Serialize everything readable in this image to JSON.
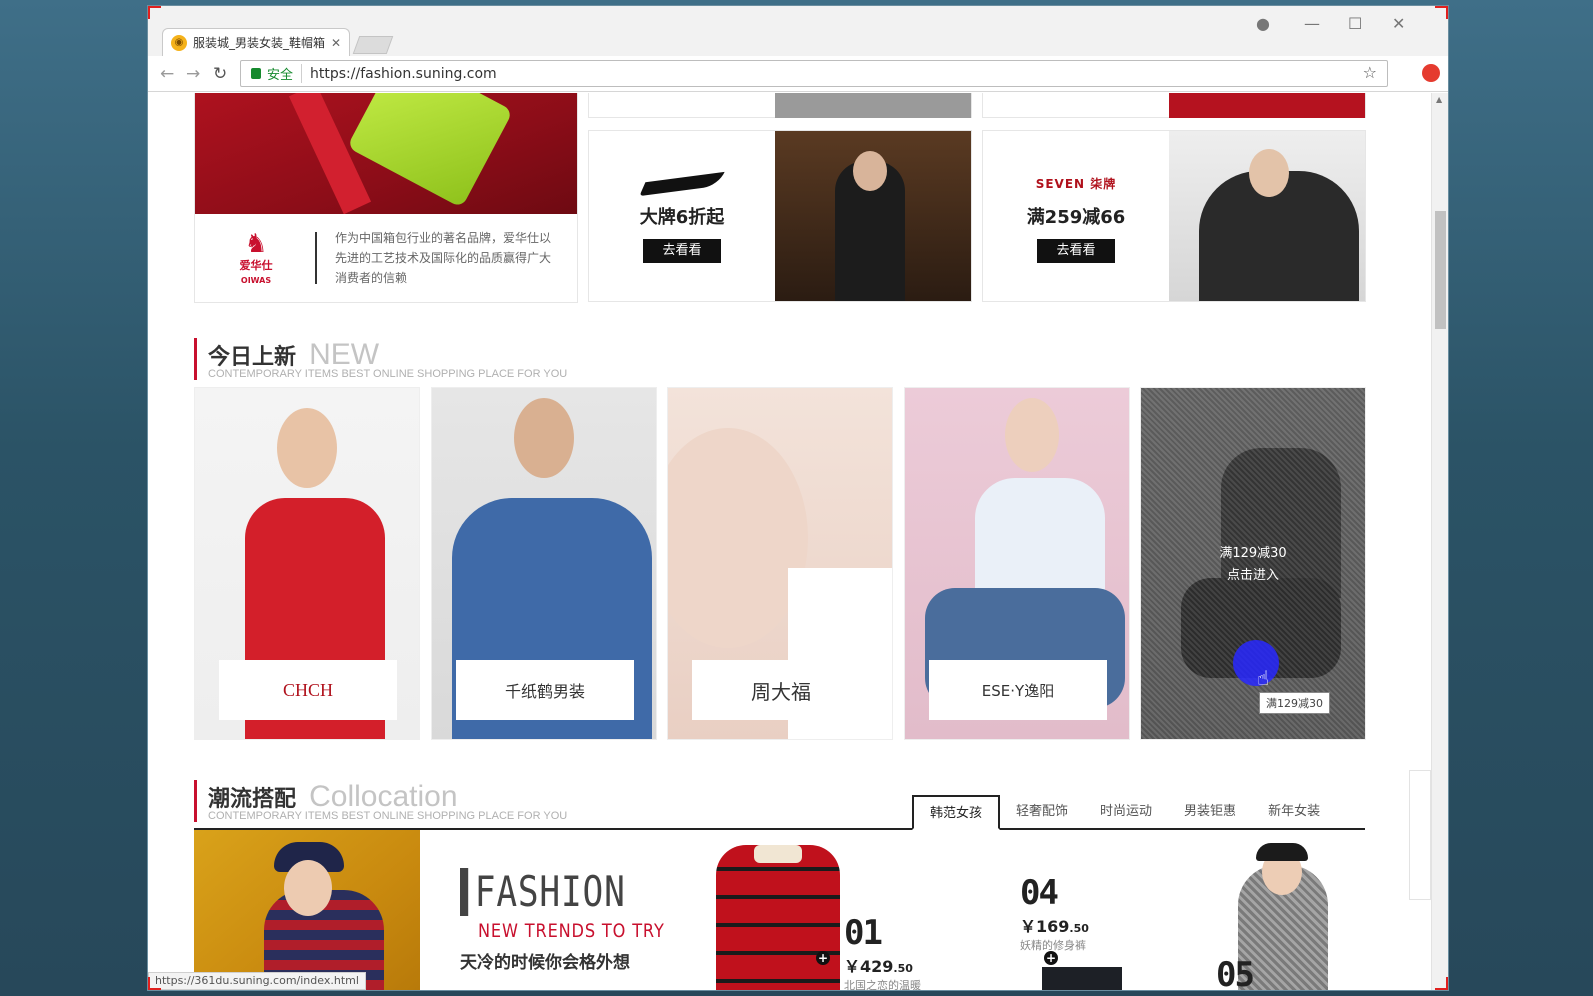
{
  "browser": {
    "tab_title": "服装城_男装女装_鞋帽箱",
    "secure_label": "安全",
    "url": "https://fashion.suning.com",
    "status_url": "https://361du.suning.com/index.html"
  },
  "promos": {
    "left_desc": "作为中国箱包行业的著名品牌，爱华仕以先进的工艺技术及国际化的品质赢得广大消费者的信赖",
    "left_brand": "爱华仕",
    "left_brand_en": "OIWAS",
    "cards": [
      {
        "brand": "nike",
        "slogan": "大牌6折起",
        "button": "去看看"
      },
      {
        "brand": "SEVEN 柒牌",
        "slogan": "满259减66",
        "button": "去看看"
      }
    ]
  },
  "new_section": {
    "title_cn": "今日上新",
    "title_en": "NEW",
    "subtitle": "CONTEMPORARY ITEMS BEST ONLINE SHOPPING PLACE FOR YOU",
    "items": [
      {
        "label": "CHCH",
        "color": "#d31f2a"
      },
      {
        "label": "千纸鹤男装",
        "color": "#3f6aa8"
      },
      {
        "label": "周大福",
        "color": "#e9cfc3"
      },
      {
        "label": "ESE·Y逸阳",
        "color": "#e7c7d3"
      },
      {
        "label": "",
        "color": "#5b5b5b"
      }
    ],
    "hover": {
      "line1": "满129减30",
      "line2": "点击进入",
      "tooltip": "满129减30"
    }
  },
  "collocation": {
    "title_cn": "潮流搭配",
    "title_en": "Collocation",
    "subtitle": "CONTEMPORARY ITEMS BEST ONLINE SHOPPING PLACE FOR YOU",
    "tabs": [
      "韩范女孩",
      "轻奢配饰",
      "时尚运动",
      "男装钜惠",
      "新年女装"
    ],
    "active_tab": 0,
    "fashion": {
      "word": "FASHION",
      "sub": "NEW TRENDS TO TRY",
      "cn": "天冷的时候你会格外想"
    },
    "products": [
      {
        "num": "01",
        "price_yen": "￥",
        "price_int": "429",
        "price_dec": ".50",
        "name": "北国之恋的温暖"
      },
      {
        "num": "04",
        "price_yen": "￥",
        "price_int": "169",
        "price_dec": ".50",
        "name": "妖精的修身裤"
      },
      {
        "num": "05"
      }
    ]
  }
}
